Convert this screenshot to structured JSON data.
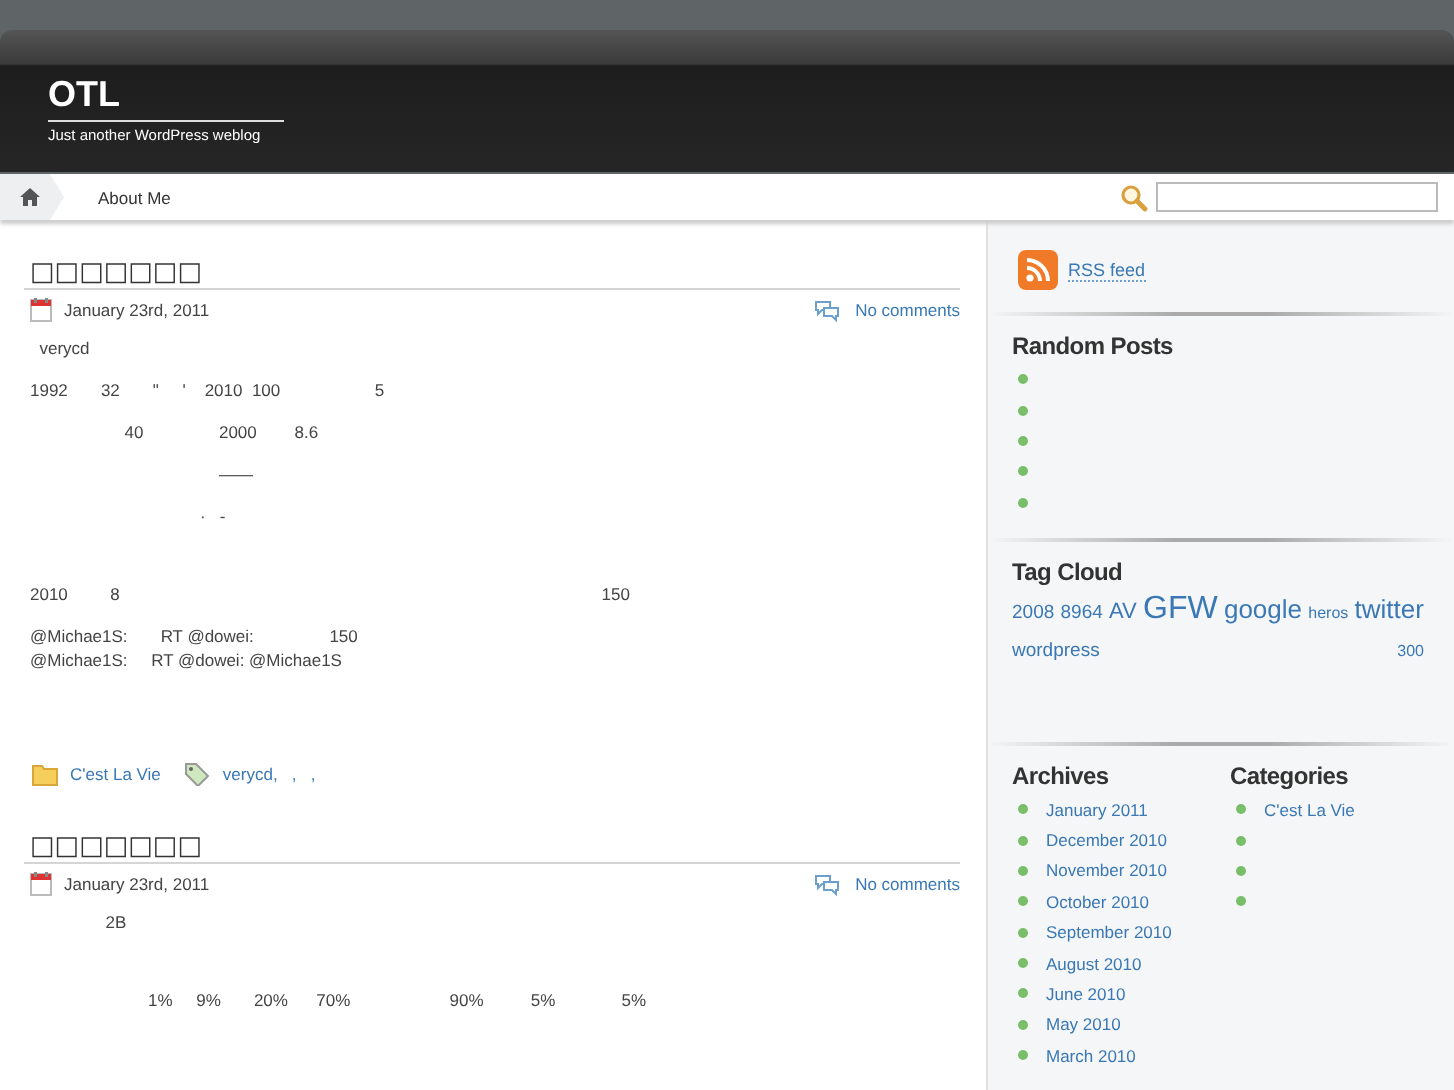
{
  "site": {
    "title": "OTL",
    "tagline": "Just another WordPress weblog"
  },
  "nav": {
    "items": [
      {
        "kind": "home",
        "selected": false
      },
      {
        "kind": "page",
        "label": "About Me",
        "selected": false
      }
    ]
  },
  "posts": [
    {
      "title": "□□□□□□□",
      "date": "January 23rd, 2011",
      "comments": "No comments",
      "paragraphs": [
        {
          "kind": "text",
          "lines": [
            "  verycd"
          ]
        },
        {
          "kind": "text",
          "lines": [
            "1992       32       \"     '    2010  100                    5"
          ]
        },
        {
          "kind": "text",
          "lines": [
            "                    40                2000        8.6"
          ]
        },
        {
          "kind": "text",
          "lines": [
            "                                        ——"
          ]
        },
        {
          "kind": "text",
          "lines": [
            "                                    ·   -"
          ]
        },
        {
          "kind": "gap"
        },
        {
          "kind": "text",
          "lines": [
            "2010         8                                                                                                      150"
          ]
        },
        {
          "kind": "text",
          "lines": [
            "@Michae1S:       RT @dowei:                150",
            "@Michae1S:     RT @dowei: @Michae1S"
          ]
        }
      ],
      "category": "C'est La Vie",
      "tags": "verycd,   ,   ,"
    },
    {
      "title": "□□□□□□□",
      "date": "January 23rd, 2011",
      "comments": "No comments",
      "paragraphs": [
        {
          "kind": "text",
          "lines": [
            "                2B"
          ]
        },
        {
          "kind": "gap"
        },
        {
          "kind": "text",
          "lines": [
            "                         1%     9%       20%      70%                     90%          5%              5%"
          ]
        }
      ]
    }
  ],
  "sidebar": {
    "rss": "RSS feed",
    "random_posts": {
      "title": "Random Posts",
      "items": [
        {
          "kind": "bullet"
        },
        {
          "kind": "bullet"
        },
        {
          "kind": "bullet"
        },
        {
          "kind": "bullet"
        },
        {
          "kind": "bullet"
        }
      ]
    },
    "tag_cloud": {
      "title": "Tag Cloud",
      "tags": [
        {
          "label": "2008",
          "kind": "small"
        },
        {
          "label": "8964",
          "kind": "small"
        },
        {
          "label": "AV",
          "kind": "medium"
        },
        {
          "label": "GFW",
          "kind": "xlarge"
        },
        {
          "label": "google",
          "kind": "large"
        },
        {
          "label": "heros",
          "kind": "tiny"
        },
        {
          "label": "twitter",
          "kind": "large"
        },
        {
          "label": "wordpress",
          "kind": "small"
        },
        {
          "label": "300",
          "kind": "tiny"
        }
      ]
    },
    "archives": {
      "title": "Archives",
      "items": [
        {
          "kind": "link",
          "label": "January 2011"
        },
        {
          "kind": "link",
          "label": "December 2010"
        },
        {
          "kind": "link",
          "label": "November 2010"
        },
        {
          "kind": "link",
          "label": "October 2010"
        },
        {
          "kind": "link",
          "label": "September 2010"
        },
        {
          "kind": "link",
          "label": "August 2010"
        },
        {
          "kind": "link",
          "label": "June 2010"
        },
        {
          "kind": "link",
          "label": "May 2010"
        },
        {
          "kind": "link",
          "label": "March 2010"
        }
      ]
    },
    "categories": {
      "title": "Categories",
      "items": [
        {
          "kind": "link",
          "label": "C'est La Vie"
        },
        {
          "kind": "bullet"
        },
        {
          "kind": "bullet"
        },
        {
          "kind": "bullet"
        }
      ]
    }
  }
}
